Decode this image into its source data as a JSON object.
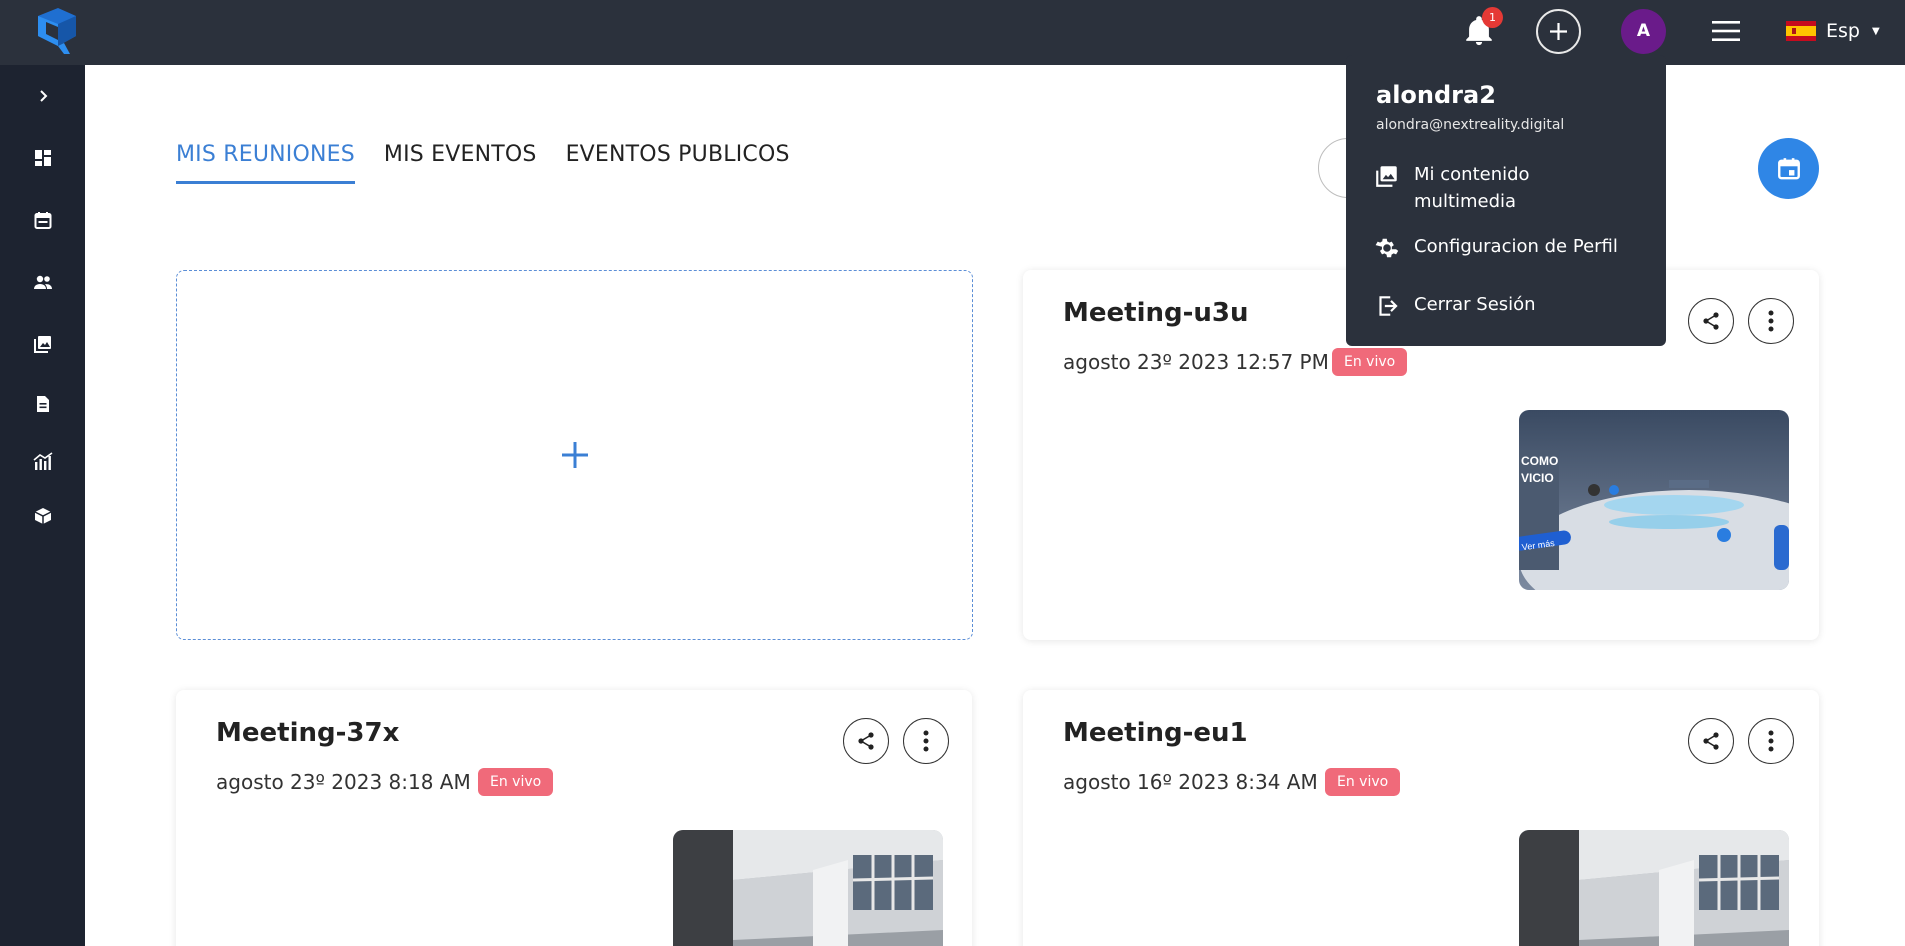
{
  "header": {
    "notification_count": "1",
    "avatar_initial": "A",
    "language": "Esp"
  },
  "tabs": [
    {
      "label": "MIS REUNIONES",
      "active": true
    },
    {
      "label": "MIS EVENTOS",
      "active": false
    },
    {
      "label": "EVENTOS PUBLICOS",
      "active": false
    }
  ],
  "sidebar": {
    "items": [
      {
        "icon": "chevron-right-icon"
      },
      {
        "icon": "dashboard-icon"
      },
      {
        "icon": "calendar-icon"
      },
      {
        "icon": "people-icon"
      },
      {
        "icon": "images-icon"
      },
      {
        "icon": "document-icon"
      },
      {
        "icon": "analytics-icon"
      },
      {
        "icon": "cube-icon"
      }
    ]
  },
  "add_card": {
    "icon": "plus-icon"
  },
  "meetings": [
    {
      "title": "Meeting-u3u",
      "date": "agosto 23º 2023 12:57 PM",
      "status": "En vivo"
    },
    {
      "title": "Meeting-37x",
      "date": "agosto 23º 2023 8:18 AM",
      "status": "En vivo"
    },
    {
      "title": "Meeting-eu1",
      "date": "agosto 16º 2023 8:34 AM",
      "status": "En vivo"
    }
  ],
  "thumbnail_text": {
    "line1": "COMO",
    "line2": "VICIO",
    "button": "Ver más"
  },
  "user_menu": {
    "username": "alondra2",
    "email": "alondra@nextreality.digital",
    "items": [
      {
        "label_line1": "Mi contenido",
        "label_line2": "multimedia",
        "icon": "images-icon"
      },
      {
        "label_line1": "Configuracion de Perfil",
        "label_line2": "",
        "icon": "gear-icon"
      },
      {
        "label_line1": "Cerrar Sesión",
        "label_line2": "",
        "icon": "logout-icon"
      }
    ]
  },
  "colors": {
    "topbar": "#2b313c",
    "sidebar": "#1d2330",
    "accent": "#3b7fd4",
    "badge": "#f06a7a",
    "avatar": "#6a1b8a"
  }
}
